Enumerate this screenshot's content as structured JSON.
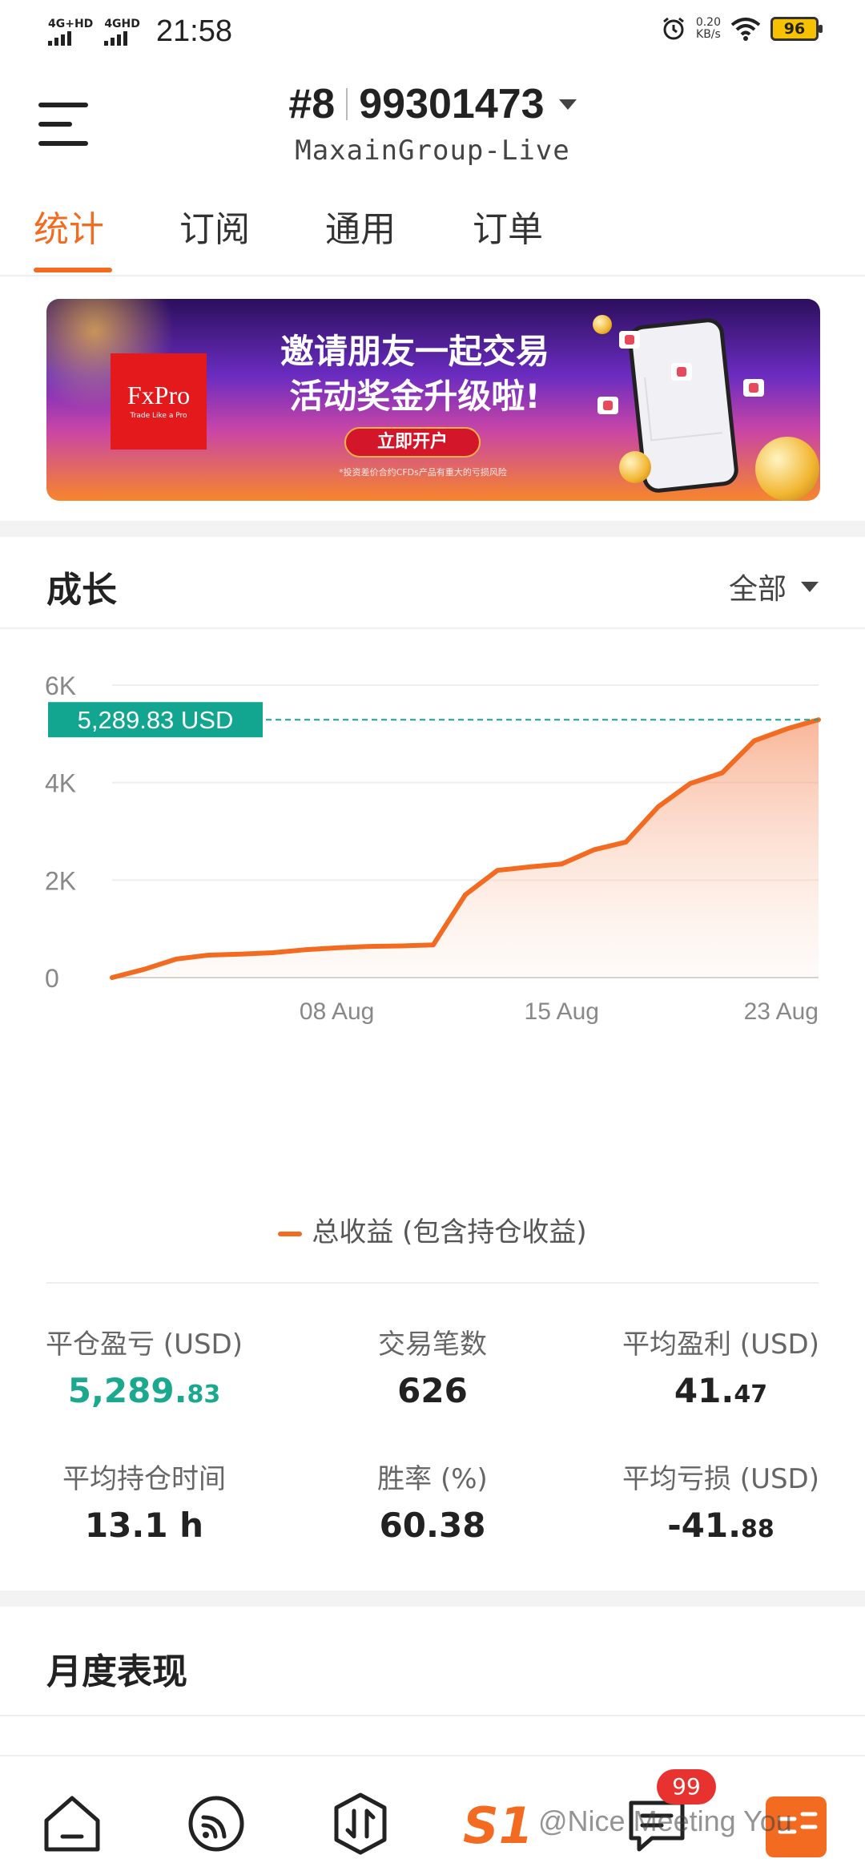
{
  "status_bar": {
    "sim1": "4G+HD",
    "sim2": "4GHD",
    "time": "21:58",
    "net_speed_value": "0.20",
    "net_speed_unit": "KB/s",
    "battery": "96"
  },
  "header": {
    "account_prefix": "#8",
    "account_number": "99301473",
    "server": "MaxainGroup-Live"
  },
  "tabs": [
    {
      "label": "统计",
      "active": true
    },
    {
      "label": "订阅",
      "active": false
    },
    {
      "label": "通用",
      "active": false
    },
    {
      "label": "订单",
      "active": false
    }
  ],
  "banner": {
    "brand": "FxPro",
    "brand_tagline": "Trade Like a Pro",
    "title_line1": "邀请朋友一起交易",
    "title_line2": "活动奖金升级啦!",
    "button": "立即开户",
    "disclaimer": "*投资差价合约CFDs产品有重大的亏损风险"
  },
  "growth": {
    "title": "成长",
    "range": "全部"
  },
  "chart_data": {
    "type": "area",
    "y_ticks": [
      "0",
      "2K",
      "4K",
      "6K"
    ],
    "x_ticks": [
      "08 Aug",
      "15 Aug",
      "23 Aug"
    ],
    "ylim": [
      0,
      6000
    ],
    "current_value_label": "5,289.83 USD",
    "current_value": 5289.83,
    "series": [
      {
        "name": "总收益 (包含持仓收益)",
        "color": "#f26b21",
        "x": [
          "01 Aug",
          "02 Aug",
          "03 Aug",
          "04 Aug",
          "05 Aug",
          "06 Aug",
          "07 Aug",
          "08 Aug",
          "09 Aug",
          "10 Aug",
          "11 Aug",
          "12 Aug",
          "13 Aug",
          "14 Aug",
          "15 Aug",
          "16 Aug",
          "17 Aug",
          "18 Aug",
          "19 Aug",
          "20 Aug",
          "21 Aug",
          "22 Aug",
          "23 Aug"
        ],
        "values": [
          0,
          170,
          380,
          460,
          480,
          510,
          570,
          610,
          640,
          650,
          670,
          1700,
          2200,
          2270,
          2330,
          2620,
          2780,
          3500,
          3980,
          4200,
          4860,
          5100,
          5289.83
        ]
      }
    ],
    "grid": true
  },
  "stats": [
    {
      "label": "平仓盈亏 (USD)",
      "int": "5,289.",
      "dec": "83",
      "green": true
    },
    {
      "label": "交易笔数",
      "int": "626",
      "dec": "",
      "green": false
    },
    {
      "label": "平均盈利 (USD)",
      "int": "41.",
      "dec": "47",
      "green": false
    },
    {
      "label": "平均持仓时间",
      "int": "13.1 h",
      "dec": "",
      "green": false
    },
    {
      "label": "胜率 (%)",
      "int": "60.38",
      "dec": "",
      "green": false
    },
    {
      "label": "平均亏损 (USD)",
      "int": "-41.",
      "dec": "88",
      "green": false
    }
  ],
  "monthly": {
    "title": "月度表现"
  },
  "bottom_nav": {
    "messages_badge": "99",
    "watermark": "@Nice Meeting You"
  },
  "colors": {
    "accent": "#f26b21",
    "profit": "#1aa88f",
    "price_tag": "#12a58f"
  }
}
